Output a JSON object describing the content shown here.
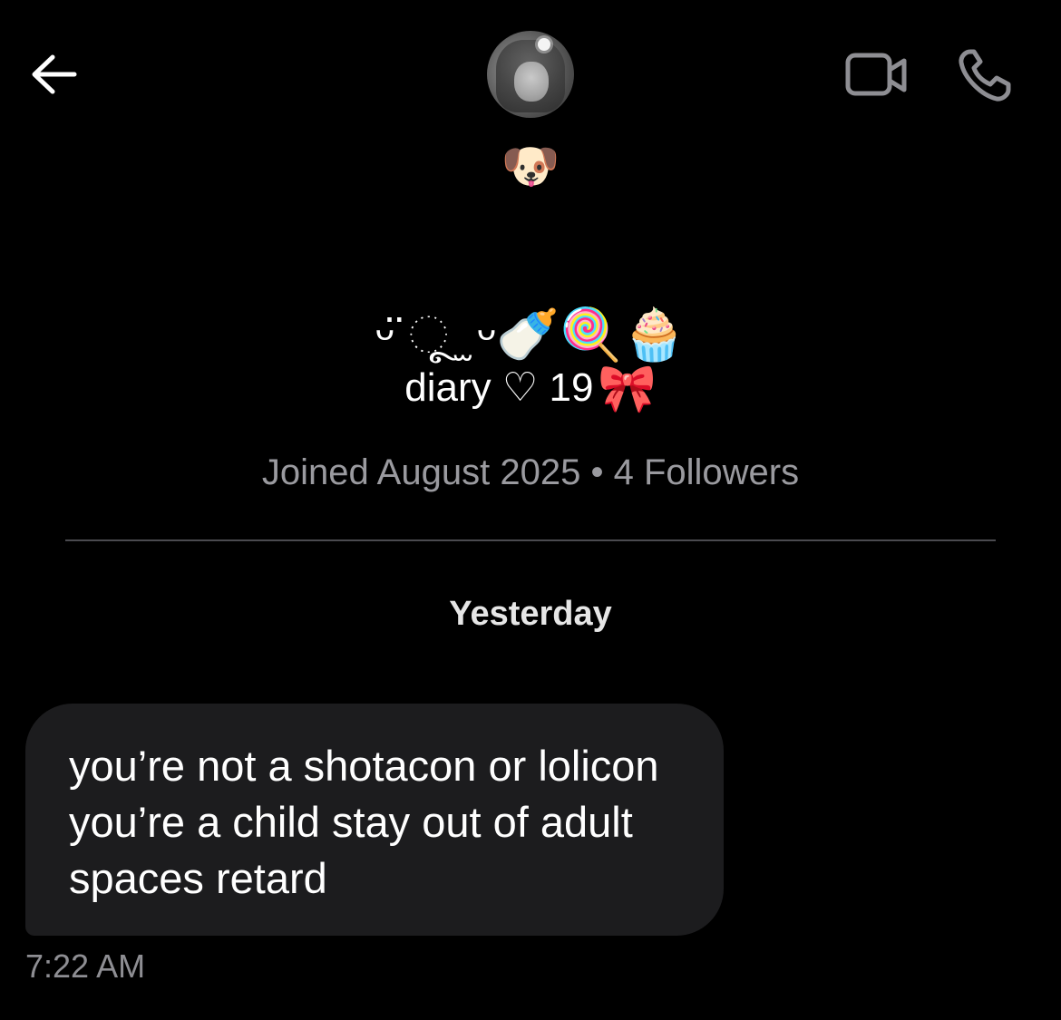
{
  "header": {
    "back_icon": "arrow-left-icon",
    "video_icon": "video-camera-icon",
    "call_icon": "phone-icon",
    "avatar": "profile-photo"
  },
  "profile": {
    "status_emoji": "🐶",
    "name_line1": "ᵕ̈ ૂ ̫ ᵕ🍼🍭🧁",
    "name_text": "diary ♡ 19",
    "name_emoji": "🎀",
    "joined": "Joined August 2025",
    "separator": "•",
    "followers": "4 Followers"
  },
  "chat": {
    "date_label": "Yesterday",
    "messages": [
      {
        "text": "you’re not a shotacon or lolicon you’re a child stay out of adult spaces retard",
        "time": "7:22 AM"
      }
    ]
  },
  "colors": {
    "background": "#000000",
    "bubble": "#1c1c1e",
    "muted_text": "#9a9a9f",
    "icon": "#8e8e93"
  }
}
